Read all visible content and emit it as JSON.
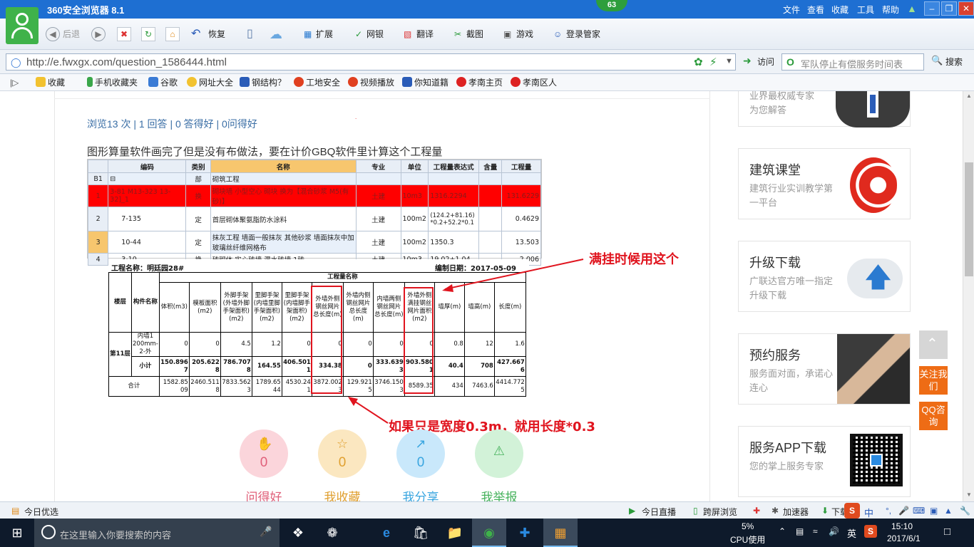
{
  "browser": {
    "title": "360安全浏览器 8.1",
    "badge": "63",
    "menu": [
      "文件",
      "查看",
      "收藏",
      "工具",
      "帮助"
    ],
    "toolbar": {
      "back": "后退",
      "restore": "恢复",
      "extend": "扩展",
      "netbank": "网银",
      "translate": "翻译",
      "screenshot": "截图",
      "games": "游戏",
      "login": "登录管家"
    },
    "address": "http://e.fwxgx.com/question_1586444.html",
    "visit": "访问",
    "search_placeholder": "军队停止有偿服务时间表",
    "search_btn": "搜索",
    "favorites": [
      "收藏",
      "手机收藏夹",
      "谷歌",
      "网址大全",
      "钢结构？",
      "工地安全",
      "视频播放",
      "你知道籍",
      "孝南主页",
      "孝南区人"
    ]
  },
  "question": {
    "stats": "浏览13 次 | 1 回答 | 0 答得好 | 0问得好",
    "title": "图形算量软件画完了但是没有布做法，要在计价GBQ软件里计算这个工程量"
  },
  "sheet1": {
    "headers": [
      "编码",
      "类别",
      "名称",
      "专业",
      "单位",
      "工程量表达式",
      "含量",
      "工程量"
    ],
    "b1_label": "B1",
    "b1": {
      "type": "部",
      "name": "砌筑工程"
    },
    "rows": [
      {
        "n": "1",
        "code": "3-81 M13-323 13-32]_1",
        "type": "换",
        "name": "砌块墙 小型空心 砌块 换为【混合砂浆 M5(有砂)】",
        "spec": "土建",
        "unit": "10m3",
        "expr": "1316.2294",
        "content": "",
        "qty": "131.6229"
      },
      {
        "n": "2",
        "code": "7-135",
        "type": "定",
        "name": "首层砌体聚氨脂防水涂料",
        "spec": "土建",
        "unit": "100m2",
        "expr": "(124.2+81.16)*0.2+52.2*0.1",
        "content": "",
        "qty": "0.4629"
      },
      {
        "n": "3",
        "code": "10-44",
        "type": "定",
        "name": "抹灰工程 墙面一般抹灰 其他砂浆 墙面抹灰中加玻璃丝纤维网格布",
        "spec": "土建",
        "unit": "100m2",
        "expr": "1350.3",
        "content": "",
        "qty": "13.503"
      },
      {
        "n": "4",
        "code": "3-10",
        "type": "换",
        "name": "砖砌体 实心砖墙 混水砖墙 1砖",
        "spec": "土建",
        "unit": "10m3",
        "expr": "19.02+1.04",
        "content": "",
        "qty": "2.006"
      }
    ]
  },
  "sheet2": {
    "project": "工程名称：明廷园28#",
    "date": "编制日期：2017-05-09",
    "group_header": "工程量名称",
    "col_floor": "楼层",
    "col_member": "构件名称",
    "columns": [
      "体积(m3)",
      "模板面积(m2)",
      "外脚手架(外墙外脚手架面积)(m2)",
      "里脚手架(内墙里脚手架面积)(m2)",
      "里脚手架(内墙脚手架面积)(m2)",
      "外墙外侧钢丝网片总长度(m)",
      "外墙内侧钢丝网片总长度(m)",
      "内墙两侧钢丝网片总长度(m)",
      "外墙外侧满挂钢丝网片面积(m2)",
      "墙厚(m)",
      "墙高(m)",
      "长度(m)"
    ],
    "floor": "第11层",
    "member": "内墙1 200mm-2-外",
    "row_member": [
      "0",
      "0",
      "4.5",
      "1.2",
      "0",
      "0",
      "0",
      "0",
      "0",
      "0.8",
      "12",
      "1.6"
    ],
    "subtotal_label": "小计",
    "row_subtotal": [
      "150.8967",
      "205.6228",
      "786.7078",
      "164.55",
      "406.5011",
      "334.38",
      "0",
      "333.6393",
      "903.5801",
      "40.4",
      "708",
      "427.6676"
    ],
    "total_label": "合计",
    "row_total": [
      "1582.8509",
      "2460.5118",
      "7833.5623",
      "1789.6544",
      "4530.241",
      "3872.0023",
      "129.9215",
      "3746.1503",
      "8589.35",
      "434",
      "7463.6",
      "4414.7725"
    ]
  },
  "annotations": {
    "full": "满挂时候用这个",
    "width": "如果只是宽度0.3m，就用长度*0.3"
  },
  "actions": [
    {
      "label": "问得好",
      "count": "0",
      "icon": "thumbs-up-icon",
      "color": "#f7b9c2",
      "text": "#e0607a"
    },
    {
      "label": "我收藏",
      "count": "0",
      "icon": "star-icon",
      "color": "#fbe3b0",
      "text": "#e0a030"
    },
    {
      "label": "我分享",
      "count": "0",
      "icon": "share-icon",
      "color": "#bfe4fa",
      "text": "#3aa6e0"
    },
    {
      "label": "我举报",
      "count": "",
      "icon": "warning-icon",
      "color": "#c8f0d0",
      "text": "#46b25c"
    }
  ],
  "sidebar": {
    "top_card": [
      "业界最权威专家",
      "为您解答"
    ],
    "cards": [
      {
        "title": "建筑课堂",
        "desc": "建筑行业实训教学第一平台"
      },
      {
        "title": "升级下载",
        "desc": "广联达官方唯一指定升级下载"
      },
      {
        "title": "预约服务",
        "desc": "服务面对面，承诺心连心"
      },
      {
        "title": "服务APP下载",
        "desc": "您的掌上服务专家"
      }
    ],
    "follow": "关注我们",
    "qq": "QQ咨询"
  },
  "statusbar": {
    "left": "今日优选",
    "live": "今日直播",
    "cross": "跨屏浏览",
    "accel": "加速器",
    "download": "下载",
    "ime": "中"
  },
  "taskbar": {
    "search": "在这里输入你要搜索的内容",
    "cpu": "5%",
    "cpu_label": "CPU使用",
    "lang": "英",
    "time": "15:10",
    "date": "2017/6/1"
  }
}
